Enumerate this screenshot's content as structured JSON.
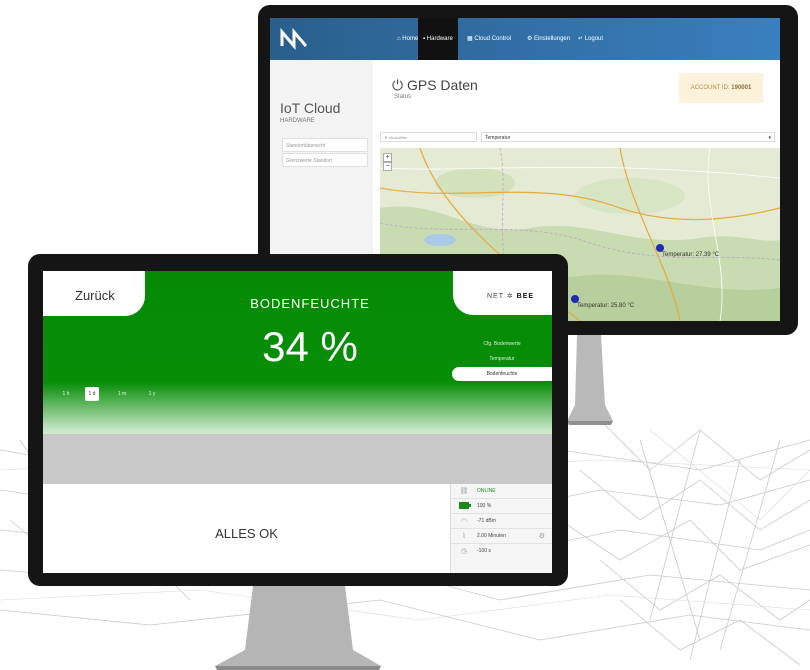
{
  "back_screen": {
    "nav": {
      "items": [
        "Home",
        "Hardware",
        "Cloud Control",
        "Einstellungen",
        "Logout"
      ],
      "active_index": 1
    },
    "sidebar": {
      "title": "IoT Cloud",
      "subtitle": "HARDWARE",
      "items": [
        "Standortübersicht",
        "Grenzwerte Standort"
      ]
    },
    "page": {
      "title": "GPS Daten",
      "subtitle": "Status",
      "account_label": "ACCOUNT ID:",
      "account_id": "190001"
    },
    "filters": {
      "modules_placeholder": "Modulfilter",
      "sensor_select": "Temperatur"
    },
    "map": {
      "zoom_in": "+",
      "zoom_out": "−",
      "markers": [
        "Temperatur: 27.39 °C",
        "Temperatur: 25.80 °C"
      ]
    }
  },
  "front_screen": {
    "back_label": "Zurück",
    "logo": {
      "net": "NET",
      "bee": "BEE"
    },
    "metric_name": "BODENFEUCHTE",
    "metric_value": "34 %",
    "sensors": [
      "Cfg. Bodenwerte",
      "Temperatur",
      "Bodenfeuchte"
    ],
    "active_sensor_index": 2,
    "time_ranges": [
      "1 h",
      "1 d",
      "1 m",
      "1 y"
    ],
    "active_range_index": 1,
    "status_message": "ALLES OK",
    "status": {
      "connection": "ONLINE",
      "battery": "100 %",
      "battery_level": 1.0,
      "signal": "-71 dBm",
      "interval": "2.00 Minuten",
      "last_seen": "-100 s"
    }
  },
  "colors": {
    "green": "#078e07",
    "online": "#1a8a1a",
    "nav_blue": "#3a7fbf",
    "marker": "#1f2bb0",
    "account_bg": "#fcf2dc"
  }
}
